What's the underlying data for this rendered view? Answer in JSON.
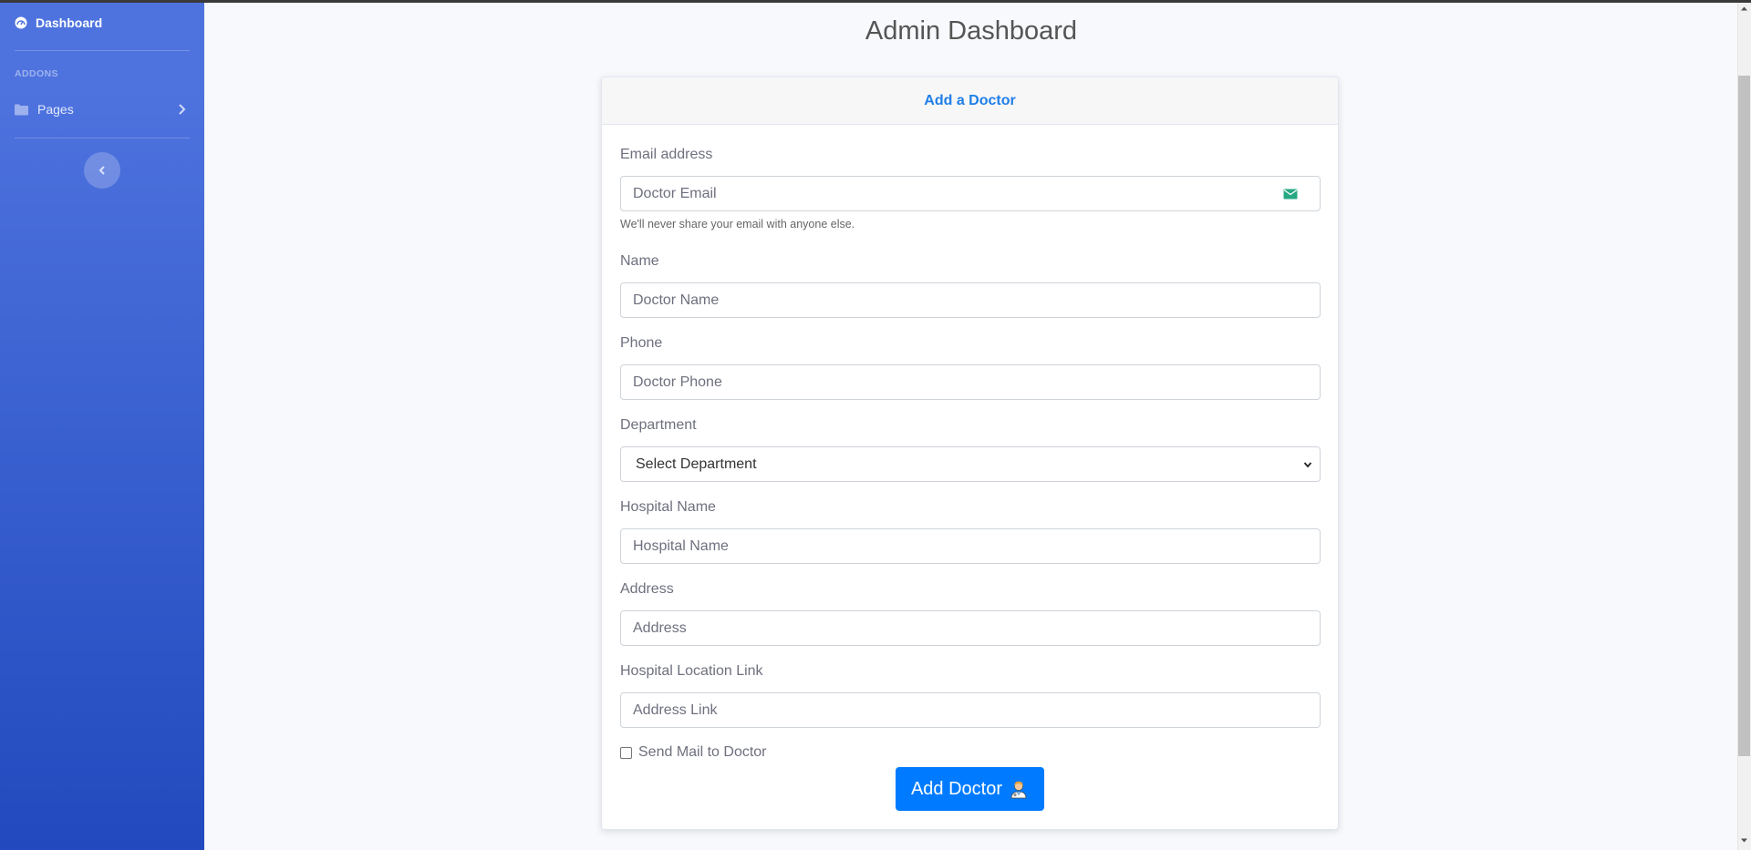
{
  "sidebar": {
    "brand_label": "Dashboard",
    "heading": "ADDONS",
    "items": [
      {
        "label": "Pages",
        "icon": "folder-icon"
      }
    ],
    "toggle_icon": "chevron-left-icon"
  },
  "page": {
    "title": "Admin Dashboard"
  },
  "form": {
    "card_title": "Add a Doctor",
    "email": {
      "label": "Email address",
      "placeholder": "Doctor Email",
      "help": "We'll never share your email with anyone else.",
      "icon": "envelope-icon"
    },
    "name": {
      "label": "Name",
      "placeholder": "Doctor Name"
    },
    "phone": {
      "label": "Phone",
      "placeholder": "Doctor Phone"
    },
    "department": {
      "label": "Department",
      "selected": "Select Department"
    },
    "hospital": {
      "label": "Hospital Name",
      "placeholder": "Hospital Name"
    },
    "address": {
      "label": "Address",
      "placeholder": "Address"
    },
    "location": {
      "label": "Hospital Location Link",
      "placeholder": "Address Link"
    },
    "send_mail_label": "Send Mail to Doctor",
    "submit_label": "Add Doctor",
    "submit_icon": "doctor-icon"
  },
  "colors": {
    "sidebar_top": "#4e73df",
    "sidebar_bottom": "#224abe",
    "primary": "#007bff",
    "header_text": "#1e7fe8"
  }
}
